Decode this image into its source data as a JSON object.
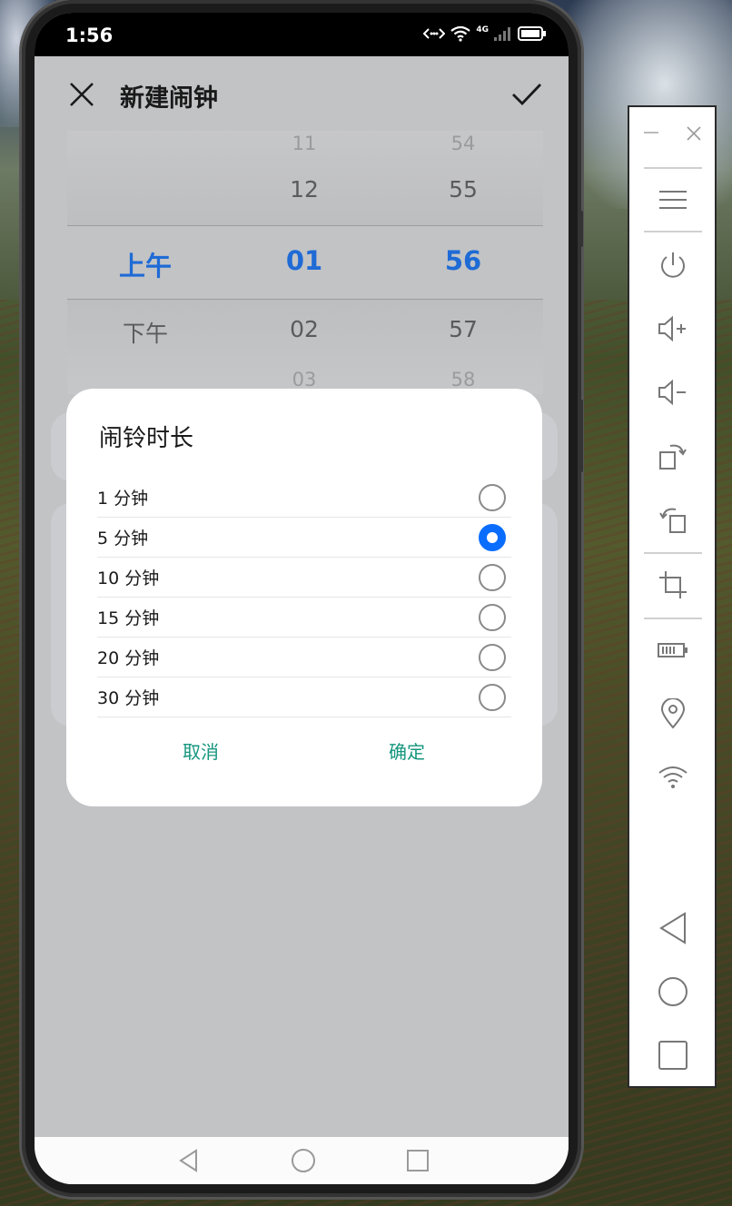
{
  "status_bar": {
    "time": "1:56",
    "network": "4G"
  },
  "header": {
    "title": "新建闹钟"
  },
  "time_picker": {
    "period_column": {
      "selected": "上午",
      "below": "下午"
    },
    "hour_column": {
      "far_above": "11",
      "above": "12",
      "selected": "01",
      "below": "02",
      "far_below": "03"
    },
    "minute_column": {
      "far_above": "54",
      "above": "55",
      "selected": "56",
      "below": "57",
      "far_below": "58"
    }
  },
  "dialog": {
    "title": "闹铃时长",
    "options": [
      {
        "label": "1 分钟",
        "selected": false
      },
      {
        "label": "5 分钟",
        "selected": true
      },
      {
        "label": "10 分钟",
        "selected": false
      },
      {
        "label": "15 分钟",
        "selected": false
      },
      {
        "label": "20 分钟",
        "selected": false
      },
      {
        "label": "30 分钟",
        "selected": false
      }
    ],
    "cancel_label": "取消",
    "confirm_label": "确定",
    "accent_color": "#15967e",
    "radio_color": "#0a6dfe"
  },
  "picker_accent_color": "#1f6bd6",
  "nav_bar": {
    "icons": [
      "back-icon",
      "home-icon",
      "recents-icon"
    ]
  },
  "emulator_toolbar": {
    "icons": [
      "minimize-icon",
      "close-icon",
      "menu-icon",
      "power-icon",
      "volume-up-icon",
      "volume-down-icon",
      "rotate-right-icon",
      "rotate-left-icon",
      "crop-icon",
      "battery-icon",
      "location-icon",
      "wifi-icon",
      "back-icon",
      "home-icon",
      "recents-icon"
    ]
  }
}
